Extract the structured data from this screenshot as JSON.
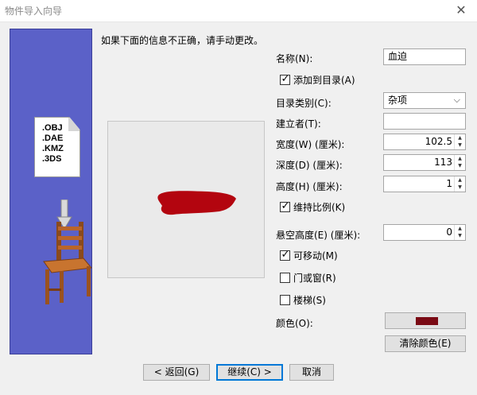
{
  "window": {
    "title": "物件导入向导",
    "close_glyph": "✕"
  },
  "sidebar": {
    "formats": [
      ".OBJ",
      ".DAE",
      ".KMZ",
      ".3DS"
    ]
  },
  "intro": "如果下面的信息不正确，请手动更改。",
  "form": {
    "name_label": "名称(N):",
    "name_value": "血迫",
    "add_catalog_label": "添加到目录(A)",
    "add_catalog_checked": true,
    "category_label": "目录类别(C):",
    "category_value": "杂项",
    "creator_label": "建立者(T):",
    "creator_value": "",
    "width_label": "宽度(W) (厘米):",
    "width_value": "102.5",
    "depth_label": "深度(D) (厘米):",
    "depth_value": "113",
    "height_label": "高度(H) (厘米):",
    "height_value": "1",
    "keep_ratio_label": "维持比例(K)",
    "keep_ratio_checked": true,
    "elevation_label": "悬空高度(E) (厘米):",
    "elevation_value": "0",
    "movable_label": "可移动(M)",
    "movable_checked": true,
    "door_window_label": "门或窗(R)",
    "door_window_checked": false,
    "stairs_label": "楼梯(S)",
    "stairs_checked": false,
    "color_label": "颜色(O):",
    "color_value": "#7a0a14",
    "clear_color_label": "清除颜色(E)"
  },
  "preview": {
    "object_color": "#b3050f"
  },
  "buttons": {
    "back": "< 返回(G)",
    "continue": "继续(C) >",
    "cancel": "取消"
  },
  "icons": {
    "check": "✓",
    "spin_up": "▲",
    "spin_down": "▼",
    "dropdown": "⌵"
  }
}
